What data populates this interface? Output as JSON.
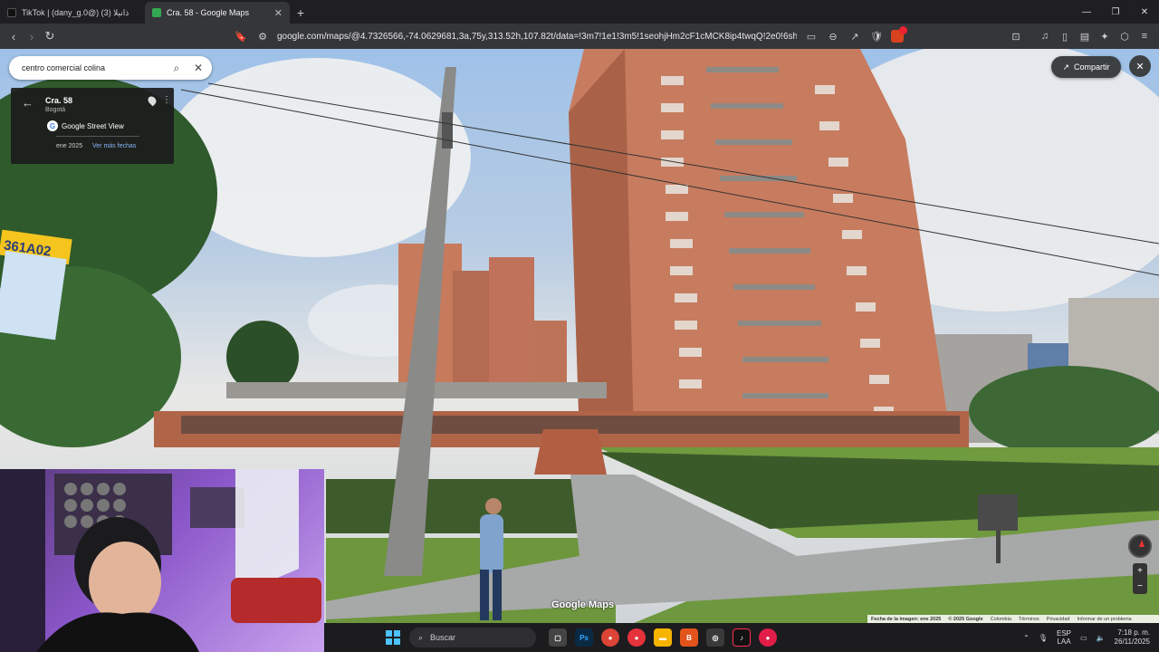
{
  "browser": {
    "tabs": [
      {
        "label": "TikTok | (dany_g.0@) ذانيلا (3)",
        "active": false
      },
      {
        "label": "Cra. 58 - Google Maps",
        "active": true
      }
    ],
    "url": "google.com/maps/@4.7326566,-74.0629681,3a,75y,313.52h,107.82t/data=!3m7!1e1!3m5!1seohjHm2cF1cMCK8ip4twqQ!2e0!6shttps:%2F..."
  },
  "maps": {
    "search": {
      "value": "centro comercial colina"
    },
    "location_card": {
      "title": "Cra. 58",
      "subtitle": "Bogotá",
      "source": "Google Street View",
      "date": "ene 2025",
      "more_dates": "Ver más fechas"
    },
    "share_label": "Compartir",
    "watermark": "Google Maps",
    "footer": {
      "imagery": "Fecha de la imagen: ene 2025",
      "copyright": "© 2025 Google",
      "country": "Colombia",
      "terms": "Términos",
      "privacy": "Privacidad",
      "report": "Informar de un problema"
    },
    "scene": {
      "bus_stop_sign": "361A02"
    }
  },
  "taskbar": {
    "search_placeholder": "Buscar",
    "lang_top": "ESP",
    "lang_bottom": "LAA",
    "time": "7:18 p. m.",
    "date": "26/11/2025"
  }
}
